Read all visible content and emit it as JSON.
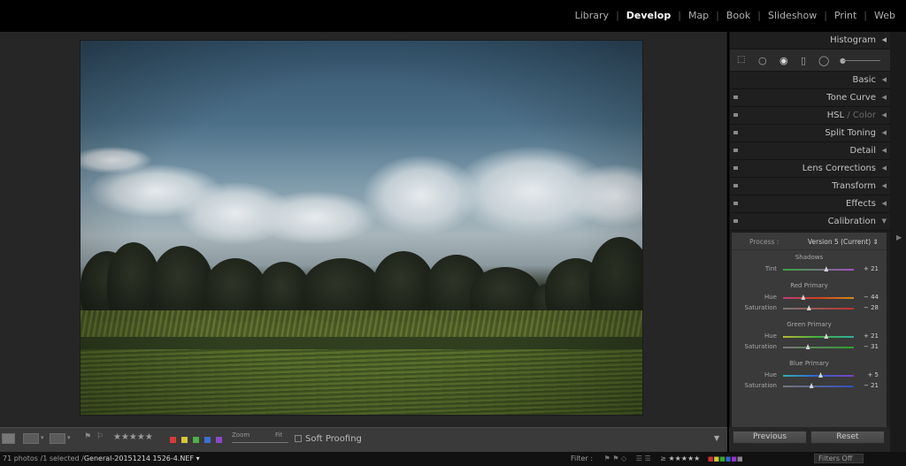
{
  "modules": [
    {
      "label": "Library",
      "active": false
    },
    {
      "label": "Develop",
      "active": true
    },
    {
      "label": "Map",
      "active": false
    },
    {
      "label": "Book",
      "active": false
    },
    {
      "label": "Slideshow",
      "active": false
    },
    {
      "label": "Print",
      "active": false
    },
    {
      "label": "Web",
      "active": false
    }
  ],
  "panels": {
    "histogram": "Histogram",
    "basic": "Basic",
    "tone_curve": "Tone Curve",
    "hsl": "HSL",
    "hsl_sep": " / ",
    "color": "Color",
    "split_toning": "Split Toning",
    "detail": "Detail",
    "lens_corrections": "Lens Corrections",
    "transform": "Transform",
    "effects": "Effects",
    "calibration": "Calibration"
  },
  "tool_icons": [
    "crop-overlay-icon",
    "spot-removal-icon",
    "red-eye-icon",
    "graduated-filter-icon",
    "radial-filter-icon",
    "adjustment-brush-icon"
  ],
  "calibration": {
    "process_label": "Process :",
    "process_value": "Version 5 (Current) ⇕",
    "shadows": {
      "title": "Shadows",
      "tint_label": "Tint",
      "tint_value": "+ 21",
      "tint_level": 0.605
    },
    "red": {
      "title": "Red Primary",
      "hue_label": "Hue",
      "hue_value": "− 44",
      "hue_level": 0.28,
      "sat_label": "Saturation",
      "sat_value": "− 28",
      "sat_level": 0.36
    },
    "green": {
      "title": "Green Primary",
      "hue_label": "Hue",
      "hue_value": "+ 21",
      "hue_level": 0.605,
      "sat_label": "Saturation",
      "sat_value": "− 31",
      "sat_level": 0.345
    },
    "blue": {
      "title": "Blue Primary",
      "hue_label": "Hue",
      "hue_value": "+ 5",
      "hue_level": 0.525,
      "sat_label": "Saturation",
      "sat_value": "− 21",
      "sat_level": 0.395
    }
  },
  "toolbar": {
    "stars": "★★★★★",
    "zoom_label": "Zoom",
    "fit_label": "Fit",
    "soft_proofing": "Soft Proofing",
    "color_labels": [
      "#d63b3b",
      "#d9c53a",
      "#4fb046",
      "#3b6fd6",
      "#8b48c8"
    ]
  },
  "buttons": {
    "previous": "Previous",
    "reset": "Reset"
  },
  "filmstrip": {
    "count": "71 photos /1 selected /",
    "filename": "General-20151214 1526-4.NEF ▾",
    "filter_label": "Filter :",
    "filter_ops": "≥",
    "filter_stars": "★★★★★",
    "filters_off": "Filters Off"
  }
}
